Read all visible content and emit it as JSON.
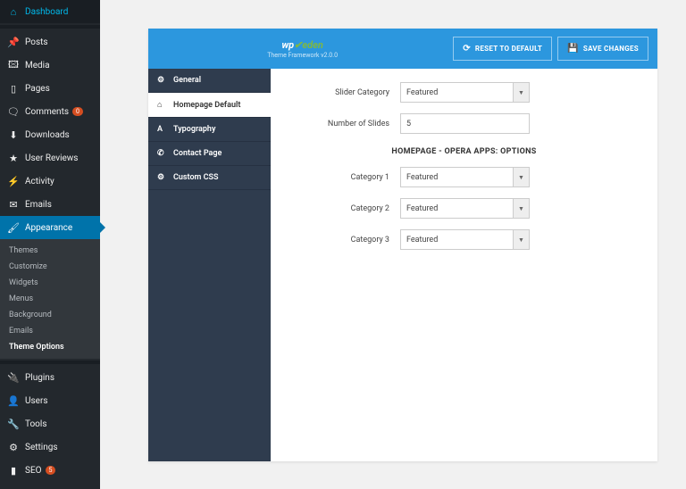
{
  "sidebar": {
    "items": [
      {
        "icon": "⌂",
        "label": "Dashboard"
      },
      {
        "icon": "📌",
        "label": "Posts"
      },
      {
        "icon": "🖾",
        "label": "Media"
      },
      {
        "icon": "▯",
        "label": "Pages"
      },
      {
        "icon": "🗨",
        "label": "Comments",
        "badge": "0"
      },
      {
        "icon": "⬇",
        "label": "Downloads"
      },
      {
        "icon": "★",
        "label": "User Reviews"
      },
      {
        "icon": "⚡",
        "label": "Activity"
      },
      {
        "icon": "✉",
        "label": "Emails"
      },
      {
        "icon": "🖌",
        "label": "Appearance",
        "active": true
      },
      {
        "icon": "🔌",
        "label": "Plugins"
      },
      {
        "icon": "👤",
        "label": "Users"
      },
      {
        "icon": "🔧",
        "label": "Tools"
      },
      {
        "icon": "⚙",
        "label": "Settings"
      },
      {
        "icon": "▮",
        "label": "SEO",
        "badge": "5"
      }
    ],
    "sub": [
      {
        "label": "Themes"
      },
      {
        "label": "Customize"
      },
      {
        "label": "Widgets"
      },
      {
        "label": "Menus"
      },
      {
        "label": "Background"
      },
      {
        "label": "Emails"
      },
      {
        "label": "Theme Options",
        "active": true
      }
    ]
  },
  "panel": {
    "brand": {
      "logo_pre": "wp",
      "logo_post": "eden",
      "sub": "Theme Framework v2.0.0"
    },
    "buttons": {
      "reset": "RESET TO DEFAULT",
      "save": "SAVE CHANGES"
    },
    "tabs": [
      {
        "icon": "⚙",
        "label": "General"
      },
      {
        "icon": "⌂",
        "label": "Homepage Default",
        "active": true
      },
      {
        "icon": "A",
        "label": "Typography"
      },
      {
        "icon": "✆",
        "label": "Contact Page"
      },
      {
        "icon": "⚙",
        "label": "Custom CSS"
      }
    ],
    "fields": {
      "slider_cat": {
        "label": "Slider Category",
        "value": "Featured"
      },
      "num_slides": {
        "label": "Number of Slides",
        "value": "5"
      },
      "section": "HOMEPAGE - OPERA APPS: OPTIONS",
      "cat1": {
        "label": "Category 1",
        "value": "Featured"
      },
      "cat2": {
        "label": "Category 2",
        "value": "Featured"
      },
      "cat3": {
        "label": "Category 3",
        "value": "Featured"
      }
    }
  }
}
